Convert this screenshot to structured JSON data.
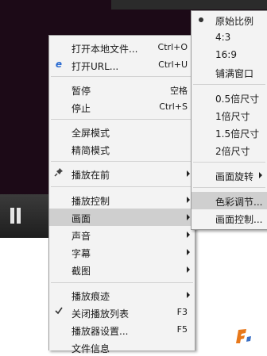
{
  "main_menu": {
    "open_local": "打开本地文件...",
    "open_local_shortcut": "Ctrl+O",
    "open_url": "打开URL...",
    "open_url_shortcut": "Ctrl+U",
    "pause": "暂停",
    "pause_shortcut": "空格",
    "stop": "停止",
    "stop_shortcut": "Ctrl+S",
    "fullscreen": "全屏模式",
    "compact": "精简模式",
    "on_top": "播放在前",
    "playback_control": "播放控制",
    "picture": "画面",
    "audio": "声音",
    "subtitle": "字幕",
    "screenshot": "截图",
    "history": "播放痕迹",
    "close_playlist": "关闭播放列表",
    "close_playlist_shortcut": "F3",
    "settings": "播放器设置...",
    "settings_shortcut": "F5",
    "file_info": "文件信息"
  },
  "sub_menu": {
    "original_ratio": "原始比例",
    "ratio_4_3": "4:3",
    "ratio_16_9": "16:9",
    "fill_window": "铺满窗口",
    "size_half": "0.5倍尺寸",
    "size_1": "1倍尺寸",
    "size_1_5": "1.5倍尺寸",
    "size_2": "2倍尺寸",
    "rotate": "画面旋转",
    "color_adjust": "色彩调节...",
    "picture_control": "画面控制..."
  },
  "colors": {
    "highlight": "#cfcfcf",
    "menu_bg": "#f3f3f3",
    "video_bg": "#1c0a17"
  },
  "icons": {
    "ie": "ie-icon",
    "pin": "pin-icon",
    "check": "check-icon",
    "pause": "pause-icon",
    "dot": "radio-dot-icon"
  }
}
